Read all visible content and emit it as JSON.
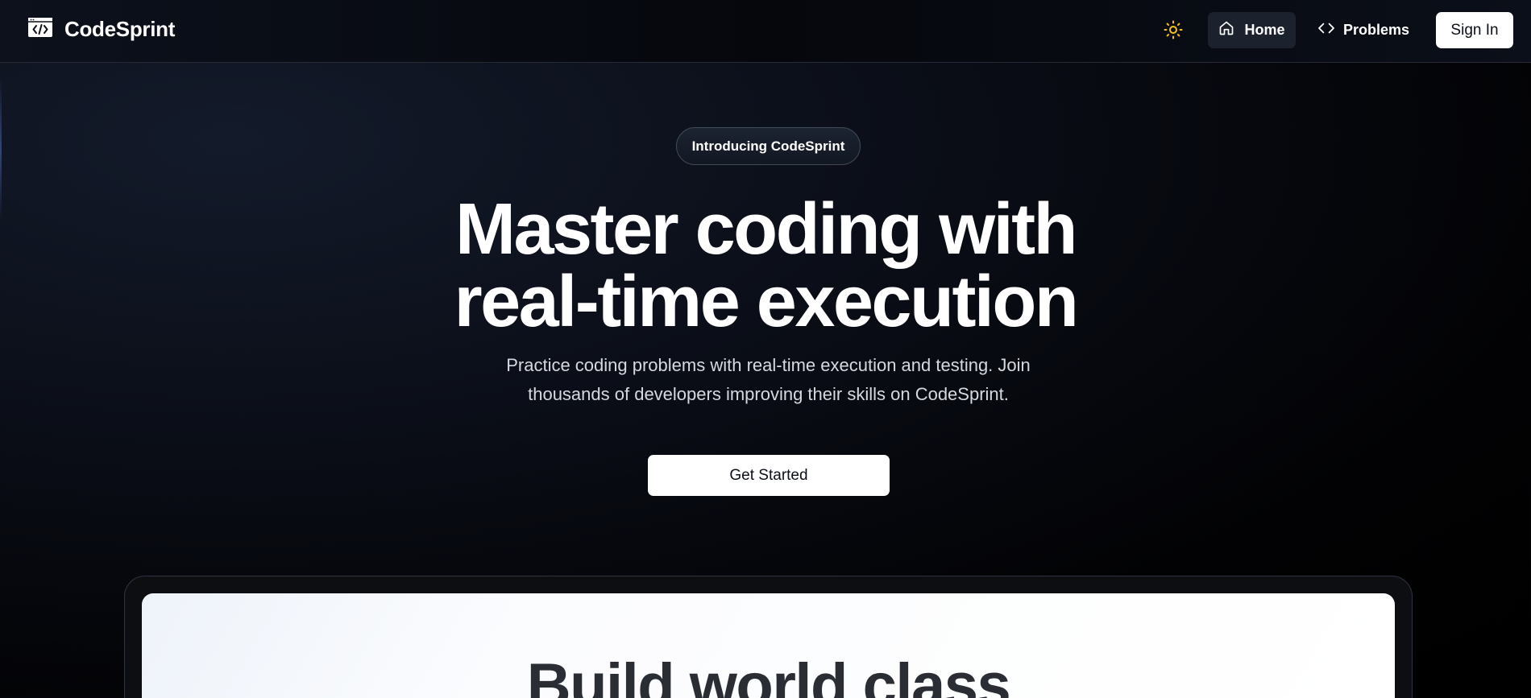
{
  "nav": {
    "brand": "CodeSprint",
    "logo_icon": "code-window-icon",
    "theme_icon": "sun-icon",
    "theme_color": "#f5c518",
    "links": [
      {
        "label": "Home",
        "icon": "home-icon",
        "active": true
      },
      {
        "label": "Problems",
        "icon": "code-brackets-icon",
        "active": false
      }
    ],
    "signin_label": "Sign In"
  },
  "hero": {
    "badge": "Introducing CodeSprint",
    "title_line1": "Master coding with",
    "title_line2": "real-time execution",
    "subtitle_line1": "Practice coding problems with real-time execution and testing. Join",
    "subtitle_line2": "thousands of developers improving their skills on CodeSprint.",
    "cta_label": "Get Started"
  },
  "preview": {
    "title": "Build world class"
  },
  "colors": {
    "background": "#05070c",
    "accent_white": "#ffffff",
    "nav_active_bg": "#1b222e"
  }
}
